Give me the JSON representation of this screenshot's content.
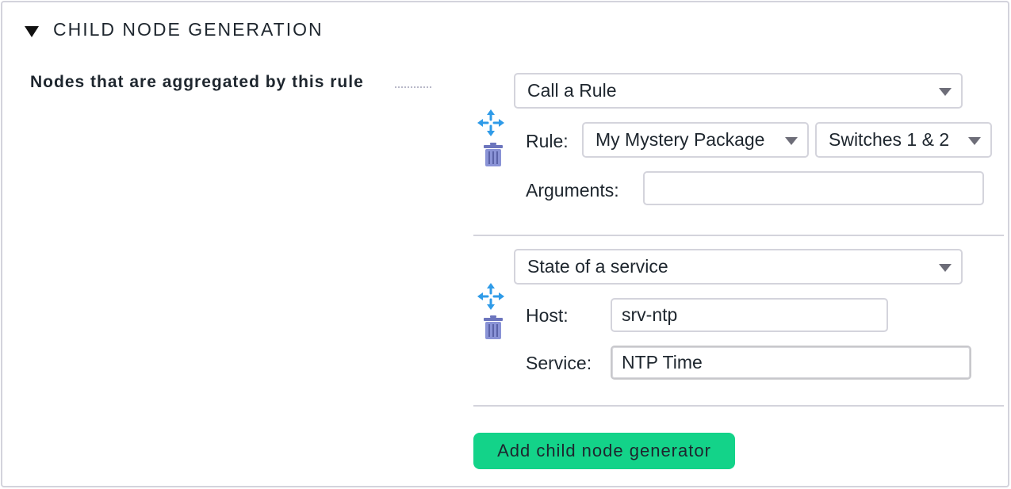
{
  "section": {
    "title": "CHILD NODE GENERATION",
    "toggle_icon": "triangle-down-icon"
  },
  "nodes_label": "Nodes that are aggregated by this rule",
  "generators": [
    {
      "type_value": "Call a Rule",
      "fields": {
        "rule_label": "Rule:",
        "rule_pack_value": "My Mystery Package",
        "rule_value": "Switches 1 & 2",
        "arguments_label": "Arguments:",
        "arguments_value": ""
      }
    },
    {
      "type_value": "State of a service",
      "fields": {
        "host_label": "Host:",
        "host_value": "srv-ntp",
        "service_label": "Service:",
        "service_value": "NTP Time"
      }
    }
  ],
  "icons": {
    "move": "move-arrows-icon",
    "delete": "trash-icon",
    "dropdown": "chevron-down-icon"
  },
  "colors": {
    "accent_green": "#13d389",
    "move_icon_blue": "#2f9be8",
    "trash_icon": "#6c75bd"
  },
  "add_button_label": "Add child node generator"
}
